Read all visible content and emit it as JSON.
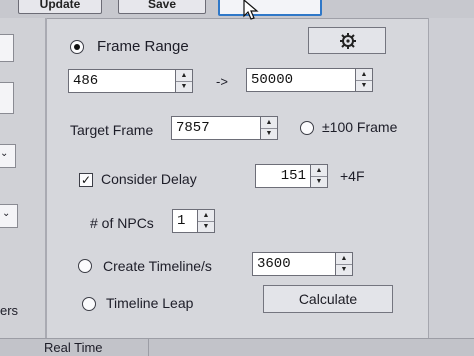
{
  "top_buttons": {
    "update": "Update",
    "save": "Save",
    "third": ""
  },
  "left_panel": {
    "partial_label": "ers"
  },
  "frame_range": {
    "label": "Frame Range",
    "start": "486",
    "arrow": "->",
    "end": "50000",
    "selected": true
  },
  "target_frame": {
    "label": "Target Frame",
    "value": "7857",
    "plusminus_label": "±100 Frame",
    "plusminus_selected": false
  },
  "consider_delay": {
    "label": "Consider Delay",
    "checked": true,
    "value": "151",
    "suffix": "+4F"
  },
  "npcs": {
    "label": "# of NPCs",
    "value": "1"
  },
  "timeline": {
    "label": "Create Timeline/s",
    "value": "3600",
    "selected": false
  },
  "timeline_leap": {
    "label": "Timeline Leap",
    "selected": false
  },
  "calculate_label": "Calculate",
  "bottom": {
    "column_header": "Real Time"
  },
  "icons": {
    "settings": "gear-icon"
  }
}
